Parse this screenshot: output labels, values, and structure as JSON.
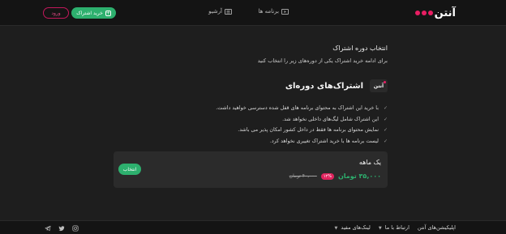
{
  "header": {
    "logo_text": "آنتن",
    "logo_dot_colors": [
      "#e91e63",
      "#e91e63",
      "#e91e63"
    ],
    "nav": [
      {
        "label": "برنامه ها",
        "icon": "play-icon"
      },
      {
        "label": "آرشیو",
        "icon": "archive-icon"
      }
    ],
    "buy_button": "خرید اشتراک",
    "login_button": "ورود"
  },
  "main": {
    "title": "انتخاب دوره اشتراک",
    "subtitle": "برای ادامه خرید اشتراک یکی از دوره‌های زیر را انتخاب کنید",
    "plan_logo": "آنتن",
    "plan_title": "اشتراک‌های دوره‌ای",
    "features": [
      "با خرید این اشتراک به محتوای برنامه های قفل شده دسترسی خواهید داشت.",
      "این اشتراک شامل لیگ‌های داخلی نخواهد شد.",
      "نمایش محتوای برنامه ها فقط در داخل کشور امکان پذیر می باشد.",
      "لیست برنامه ها با خرید اشتراک تغییری نخواهد کرد."
    ],
    "card": {
      "title": "یک ماهه",
      "old_price": "۴۰,۰۰۰ تومان",
      "discount": "۱۲%",
      "new_price": "۳۵,۰۰۰ تومان",
      "select_button": "انتخاب"
    }
  },
  "footer": {
    "links": [
      "اپلیکیشن‌های آنتن",
      "ارتباط با ما",
      "لینک‌های مفید"
    ],
    "socials": [
      "telegram-icon",
      "twitter-icon",
      "instagram-icon"
    ]
  },
  "colors": {
    "accent_green": "#2db06e",
    "accent_pink": "#e91e63",
    "background": "#1e1e1e"
  }
}
